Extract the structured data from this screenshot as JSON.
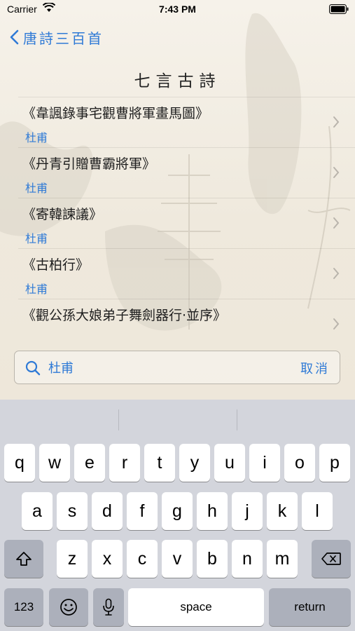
{
  "status_bar": {
    "carrier": "Carrier",
    "time": "7:43 PM"
  },
  "nav": {
    "back_label": "唐詩三百首",
    "title": "七言古詩"
  },
  "poems": [
    {
      "title": "《韋諷錄事宅觀曹將軍畫馬圖》",
      "author": "杜甫"
    },
    {
      "title": "《丹青引贈曹霸將軍》",
      "author": "杜甫"
    },
    {
      "title": "《寄韓諫議》",
      "author": "杜甫"
    },
    {
      "title": "《古柏行》",
      "author": "杜甫"
    },
    {
      "title": "《觀公孫大娘弟子舞劍器行·並序》",
      "author": ""
    }
  ],
  "search": {
    "value": "杜甫",
    "cancel_label": "取消"
  },
  "keyboard": {
    "row1": [
      "q",
      "w",
      "e",
      "r",
      "t",
      "y",
      "u",
      "i",
      "o",
      "p"
    ],
    "row2": [
      "a",
      "s",
      "d",
      "f",
      "g",
      "h",
      "j",
      "k",
      "l"
    ],
    "row3": [
      "z",
      "x",
      "c",
      "v",
      "b",
      "n",
      "m"
    ],
    "numbers_label": "123",
    "space_label": "space",
    "return_label": "return"
  },
  "colors": {
    "accent": "#2f7ad6",
    "keyboard_bg": "#d3d5dc",
    "special_key": "#acb0bb"
  }
}
